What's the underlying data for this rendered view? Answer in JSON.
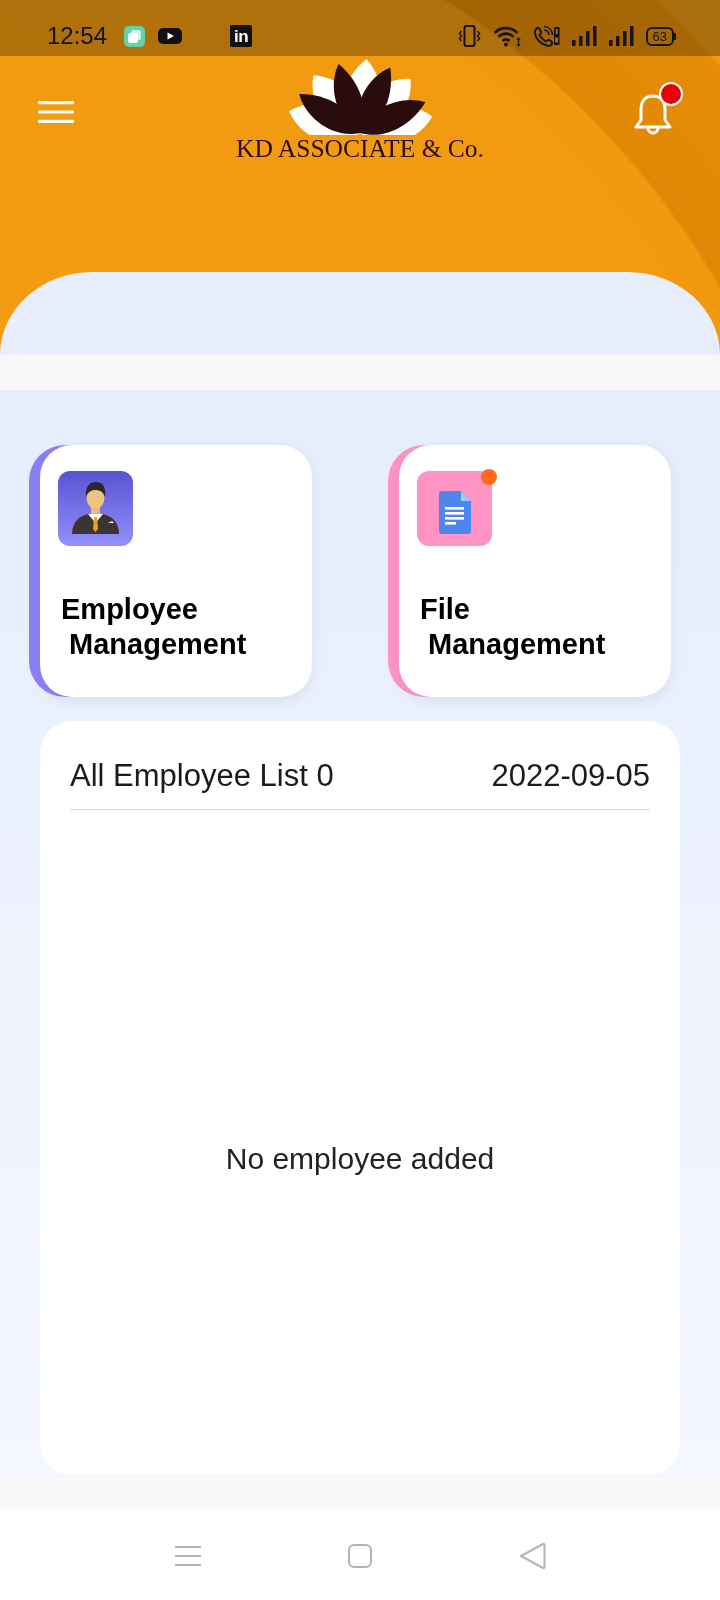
{
  "status_bar": {
    "time": "12:54",
    "app_logo": "in",
    "battery": "63"
  },
  "header": {
    "brand": "KD ASSOCIATE & Co.",
    "has_notification": true
  },
  "cards": [
    {
      "kind": "person",
      "title": "Employee\n Management",
      "color": "#8b80f5",
      "has_notification": false
    },
    {
      "kind": "document",
      "title": "File\n Management",
      "color": "#ff94c4",
      "has_notification": true
    }
  ],
  "employee_list": {
    "title": "All Employee List 0",
    "date": "2022-09-05",
    "empty_message": "No employee added"
  }
}
